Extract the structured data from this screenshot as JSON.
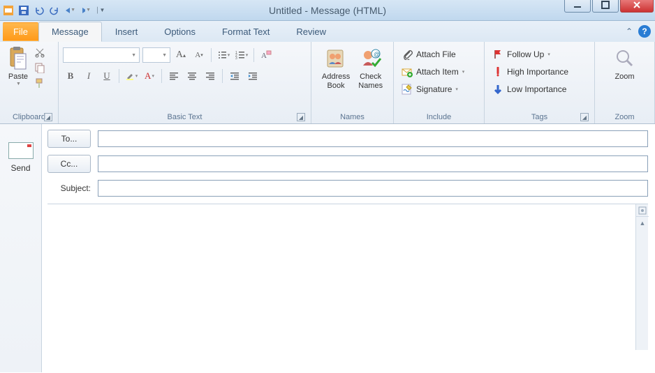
{
  "window": {
    "title": "Untitled - Message (HTML)"
  },
  "qat": {
    "icons": [
      "app-icon",
      "save-icon",
      "undo-icon",
      "redo-icon",
      "previous-item-icon",
      "next-item-icon",
      "customize-icon"
    ]
  },
  "tabs": {
    "file": "File",
    "items": [
      "Message",
      "Insert",
      "Options",
      "Format Text",
      "Review"
    ],
    "active_index": 0
  },
  "ribbon": {
    "clipboard": {
      "label": "Clipboard",
      "paste": "Paste"
    },
    "basic_text": {
      "label": "Basic Text",
      "font_name": "",
      "font_size": "",
      "bold": "B",
      "italic": "I",
      "underline": "U"
    },
    "names": {
      "label": "Names",
      "address_book": "Address\nBook",
      "check_names": "Check\nNames"
    },
    "include": {
      "label": "Include",
      "attach_file": "Attach File",
      "attach_item": "Attach Item",
      "signature": "Signature"
    },
    "tags": {
      "label": "Tags",
      "follow_up": "Follow Up",
      "high_importance": "High Importance",
      "low_importance": "Low Importance"
    },
    "zoom": {
      "label": "Zoom",
      "zoom": "Zoom"
    }
  },
  "compose": {
    "send": "Send",
    "to_label": "To...",
    "cc_label": "Cc...",
    "subject_label": "Subject:",
    "to_value": "",
    "cc_value": "",
    "subject_value": "",
    "body": ""
  }
}
